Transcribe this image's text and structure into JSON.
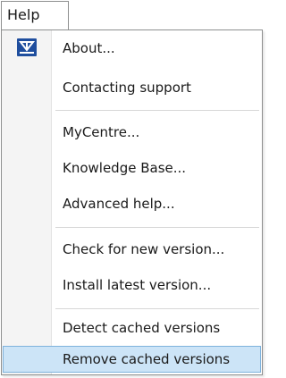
{
  "menubar": {
    "title": "Help"
  },
  "menu": {
    "items": [
      {
        "label": "About...",
        "icon": "app-logo-icon"
      },
      {
        "label": "Contacting support"
      },
      {
        "label": "MyCentre..."
      },
      {
        "label": "Knowledge Base..."
      },
      {
        "label": "Advanced help..."
      },
      {
        "label": "Check for new version..."
      },
      {
        "label": "Install latest version..."
      },
      {
        "label": "Detect cached versions"
      },
      {
        "label": "Remove cached versions",
        "state": "highlighted"
      }
    ]
  },
  "colors": {
    "highlight_fill": "#cce4f7",
    "highlight_border": "#7fb2dc",
    "icon_blue": "#1f4e9e"
  }
}
